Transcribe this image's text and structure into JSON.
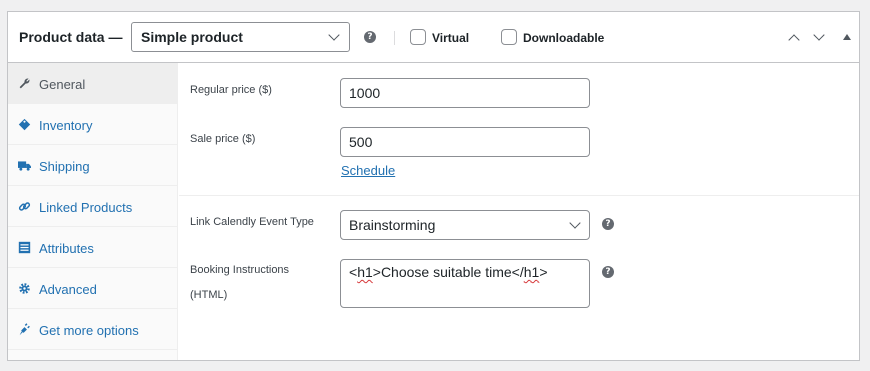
{
  "header": {
    "title": "Product data —",
    "product_type": "Simple product",
    "help": "?",
    "virtual_label": "Virtual",
    "downloadable_label": "Downloadable"
  },
  "tabs": [
    {
      "label": "General",
      "icon": "wrench-icon",
      "active": true
    },
    {
      "label": "Inventory",
      "icon": "tag-icon",
      "active": false
    },
    {
      "label": "Shipping",
      "icon": "truck-icon",
      "active": false
    },
    {
      "label": "Linked Products",
      "icon": "link-icon",
      "active": false
    },
    {
      "label": "Attributes",
      "icon": "list-icon",
      "active": false
    },
    {
      "label": "Advanced",
      "icon": "gear-icon",
      "active": false
    },
    {
      "label": "Get more options",
      "icon": "plugin-icon",
      "active": false
    }
  ],
  "general": {
    "regular_price_label": "Regular price ($)",
    "regular_price_value": "1000",
    "sale_price_label": "Sale price ($)",
    "sale_price_value": "500",
    "schedule_link": "Schedule",
    "calendly_label": "Link Calendly Event Type",
    "calendly_value": "Brainstorming",
    "booking_label_line1": "Booking Instructions",
    "booking_label_line2": "(HTML)",
    "booking_value_parts": [
      "<",
      "h1",
      ">Choose suitable time</",
      "h1",
      ">"
    ]
  },
  "colors": {
    "accent": "#2271b1",
    "border": "#c3c4c7",
    "background": "#f0f0f1"
  }
}
